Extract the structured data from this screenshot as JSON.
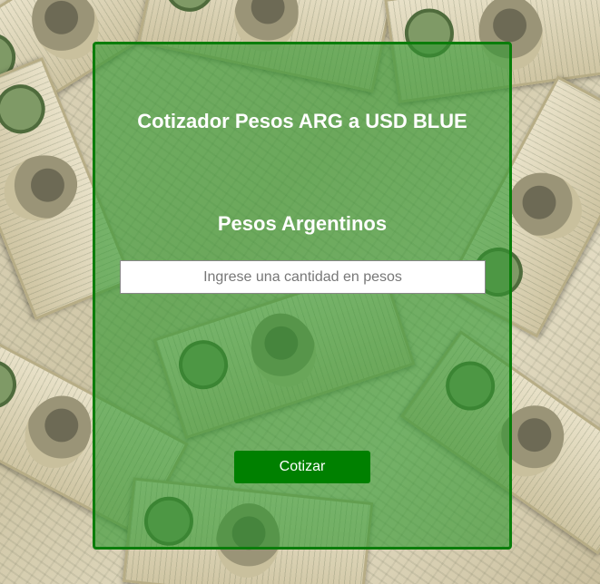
{
  "header": {
    "title": "Cotizador Pesos ARG a USD BLUE"
  },
  "form": {
    "section_label": "Pesos Argentinos",
    "input_placeholder": "Ingrese una cantidad en pesos",
    "input_value": "",
    "submit_label": "Cotizar"
  },
  "colors": {
    "panel_border": "#0a7d0a",
    "panel_fill": "#2e962e",
    "button": "#008000",
    "text": "#ffffff"
  }
}
